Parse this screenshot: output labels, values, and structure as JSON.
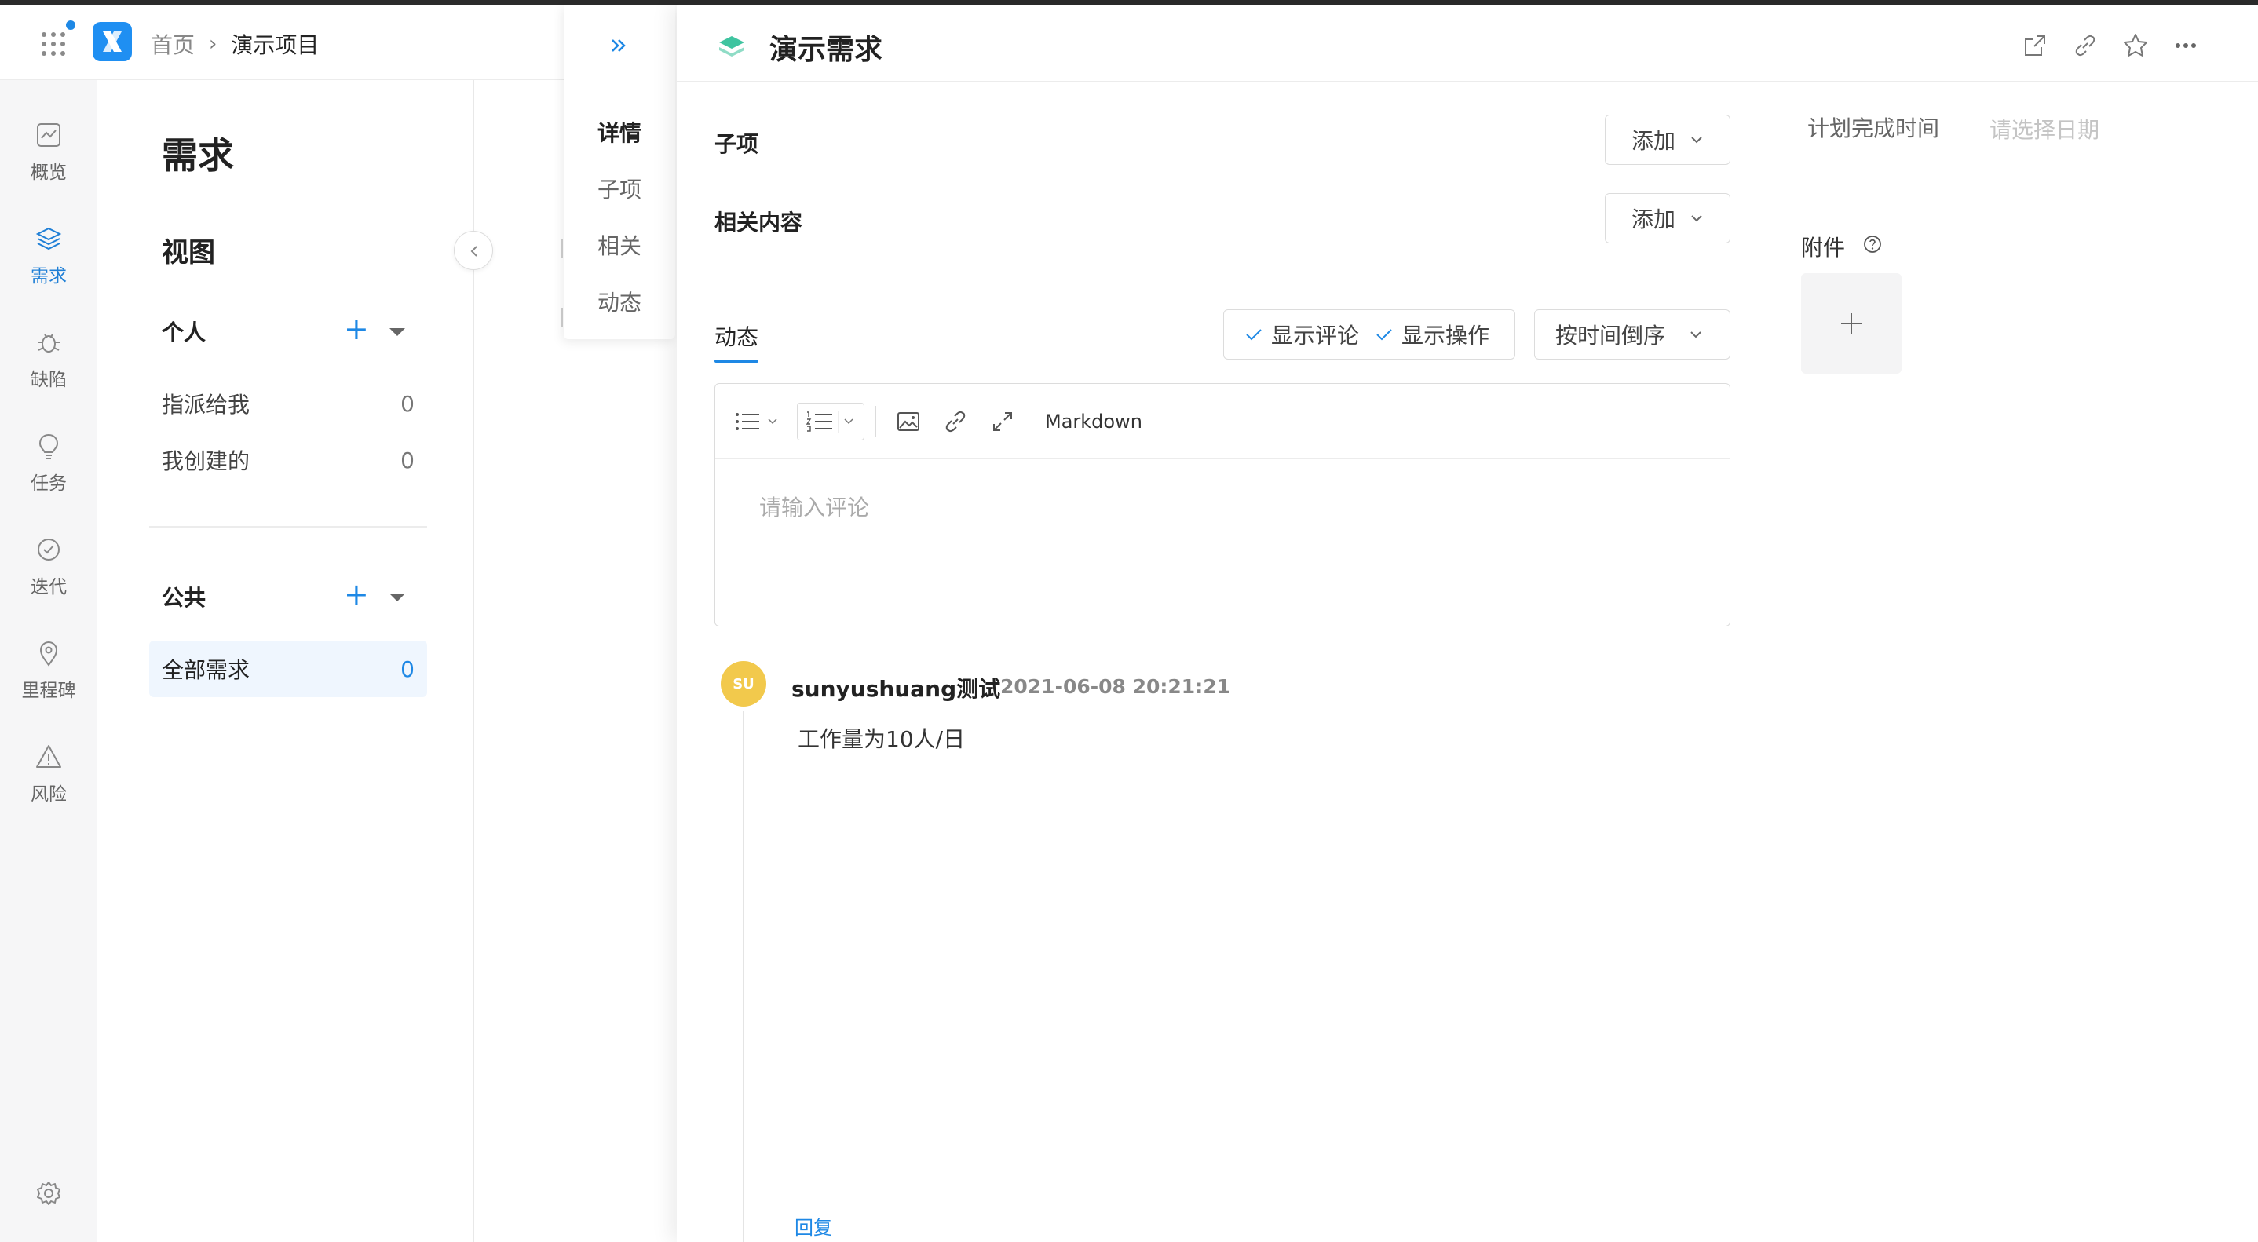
{
  "breadcrumb": {
    "home": "首页",
    "current": "演示项目"
  },
  "nav": {
    "items": [
      {
        "label": "概览",
        "icon": "overview-icon"
      },
      {
        "label": "需求",
        "icon": "layers-icon",
        "active": true
      },
      {
        "label": "缺陷",
        "icon": "bug-icon"
      },
      {
        "label": "任务",
        "icon": "bulb-icon"
      },
      {
        "label": "迭代",
        "icon": "check-circle-icon"
      },
      {
        "label": "里程碑",
        "icon": "location-pin-icon"
      },
      {
        "label": "风险",
        "icon": "warning-icon"
      }
    ],
    "settings_icon": "gear-icon"
  },
  "views": {
    "title": "需求",
    "subtitle": "视图",
    "personal": {
      "label": "个人",
      "items": [
        {
          "label": "指派给我",
          "count": "0"
        },
        {
          "label": "我创建的",
          "count": "0"
        }
      ]
    },
    "public": {
      "label": "公共",
      "items": [
        {
          "label": "全部需求",
          "count": "0",
          "active": true
        }
      ]
    }
  },
  "anchors": {
    "items": [
      "详情",
      "子项",
      "相关",
      "动态"
    ],
    "active": "详情"
  },
  "detail": {
    "title": "演示需求",
    "subitems_label": "子项",
    "related_label": "相关内容",
    "add_label": "添加",
    "activity_tab": "动态",
    "show_comments": "显示评论",
    "show_actions": "显示操作",
    "sort_label": "按时间倒序",
    "editor": {
      "markdown_label": "Markdown",
      "placeholder": "请输入评论"
    },
    "comment": {
      "avatar_initials": "SU",
      "author": "sunyushuang测试",
      "time": "2021-06-08 20:21:21",
      "text": "工作量为10人/日",
      "reply": "回复"
    },
    "right": {
      "planned_label": "计划完成时间",
      "date_placeholder": "请选择日期",
      "attachments_label": "附件"
    }
  },
  "colors": {
    "accent": "#1e88e5",
    "avatar": "#f2c94c",
    "logo": "#1f8ff2"
  }
}
